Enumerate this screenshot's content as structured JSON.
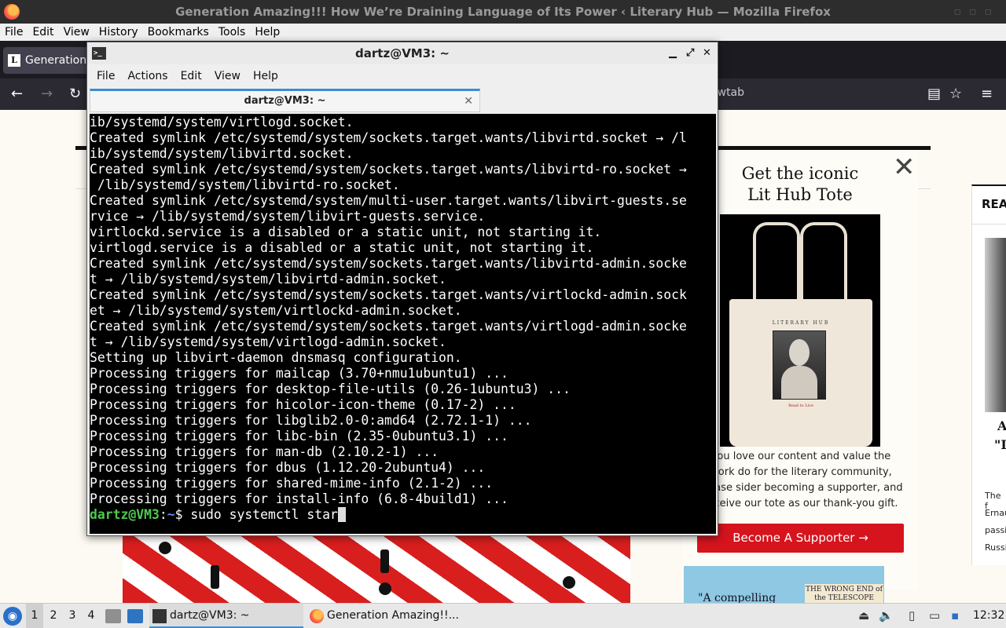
{
  "firefox": {
    "window_title": "Generation Amazing!!! How We’re Draining Language of Its Power ‹ Literary Hub — Mozilla Firefox",
    "menu": [
      "File",
      "Edit",
      "View",
      "History",
      "Bookmarks",
      "Tools",
      "Help"
    ],
    "tab_title": "Generation",
    "tab_favicon": "L",
    "url_fragment": "ewtab"
  },
  "page": {
    "modal_title_line1": "Get the iconic",
    "modal_title_line2": "Lit Hub Tote",
    "tote_brand": "LITERARY HUB",
    "tote_caption": "Read to Live",
    "modal_text": "you love our content and value the work do for the literary community, please sider becoming a supporter, and receive our tote as our thank-you gift.",
    "supporter_button": "Become A Supporter →",
    "book_quote": "\"A compelling",
    "book_title": "THE WRONG END of the TELESCOPE",
    "sidecard_heading": "REA",
    "sidecard_big1": "A",
    "sidecard_big2": "\"I",
    "sidecard_lines": [
      "The f",
      "Ernau",
      "passi",
      "Russi"
    ]
  },
  "terminal": {
    "window_title": "dartz@VM3: ~",
    "menu": [
      "File",
      "Actions",
      "Edit",
      "View",
      "Help"
    ],
    "tab_title": "dartz@VM3: ~",
    "lines": [
      "ib/systemd/system/virtlogd.socket.",
      "Created symlink /etc/systemd/system/sockets.target.wants/libvirtd.socket → /l",
      "ib/systemd/system/libvirtd.socket.",
      "Created symlink /etc/systemd/system/sockets.target.wants/libvirtd-ro.socket →",
      " /lib/systemd/system/libvirtd-ro.socket.",
      "Created symlink /etc/systemd/system/multi-user.target.wants/libvirt-guests.se",
      "rvice → /lib/systemd/system/libvirt-guests.service.",
      "virtlockd.service is a disabled or a static unit, not starting it.",
      "virtlogd.service is a disabled or a static unit, not starting it.",
      "Created symlink /etc/systemd/system/sockets.target.wants/libvirtd-admin.socke",
      "t → /lib/systemd/system/libvirtd-admin.socket.",
      "Created symlink /etc/systemd/system/sockets.target.wants/virtlockd-admin.sock",
      "et → /lib/systemd/system/virtlockd-admin.socket.",
      "Created symlink /etc/systemd/system/sockets.target.wants/virtlogd-admin.socke",
      "t → /lib/systemd/system/virtlogd-admin.socket.",
      "Setting up libvirt-daemon dnsmasq configuration.",
      "Processing triggers for mailcap (3.70+nmu1ubuntu1) ...",
      "Processing triggers for desktop-file-utils (0.26-1ubuntu3) ...",
      "Processing triggers for hicolor-icon-theme (0.17-2) ...",
      "Processing triggers for libglib2.0-0:amd64 (2.72.1-1) ...",
      "Processing triggers for libc-bin (2.35-0ubuntu3.1) ...",
      "Processing triggers for man-db (2.10.2-1) ...",
      "Processing triggers for dbus (1.12.20-2ubuntu4) ...",
      "Processing triggers for shared-mime-info (2.1-2) ...",
      "Processing triggers for install-info (6.8-4build1) ..."
    ],
    "prompt_user": "dartz@VM3",
    "prompt_sep": ":",
    "prompt_path": "~",
    "prompt_symbol": "$ ",
    "command": "sudo systemctl star"
  },
  "taskbar": {
    "workspaces": [
      "1",
      "2",
      "3",
      "4"
    ],
    "tasks": [
      "dartz@VM3: ~",
      "Generation Amazing!!..."
    ],
    "clock": "12:32"
  }
}
